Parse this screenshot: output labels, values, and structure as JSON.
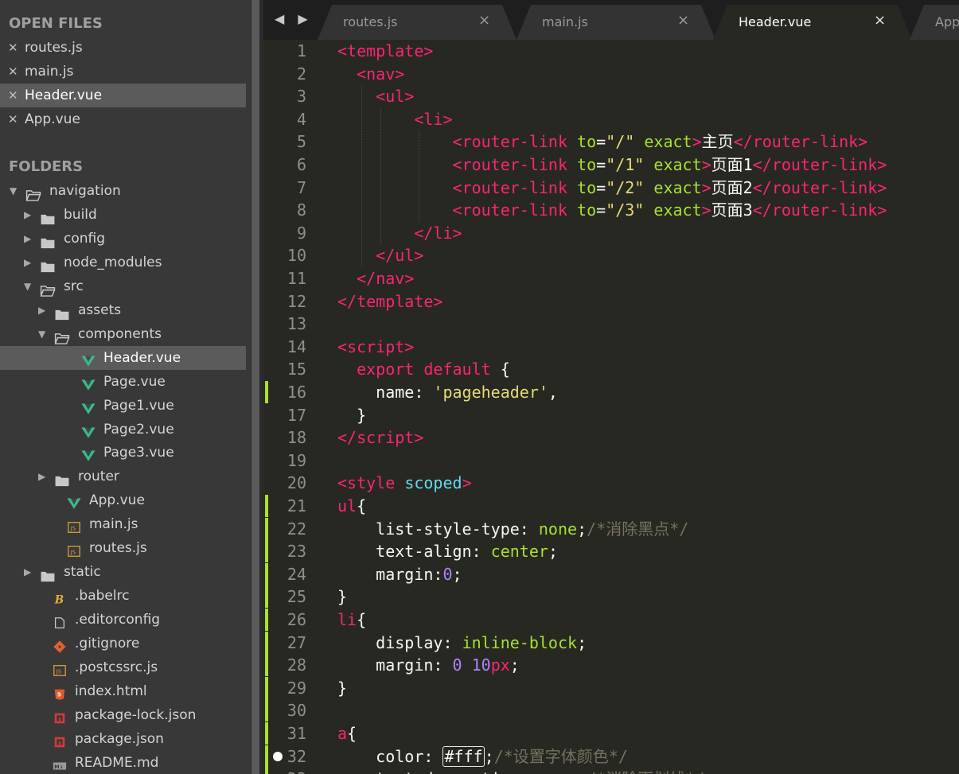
{
  "sidebar": {
    "open_files_heading": "OPEN FILES",
    "open_files": [
      {
        "label": "routes.js"
      },
      {
        "label": "main.js"
      },
      {
        "label": "Header.vue",
        "selected": true
      },
      {
        "label": "App.vue"
      }
    ],
    "folders_heading": "FOLDERS",
    "tree": [
      {
        "label": "navigation",
        "kind": "folder-open"
      },
      {
        "label": "build",
        "kind": "folder"
      },
      {
        "label": "config",
        "kind": "folder"
      },
      {
        "label": "node_modules",
        "kind": "folder"
      },
      {
        "label": "src",
        "kind": "folder-open"
      },
      {
        "label": "assets",
        "kind": "folder"
      },
      {
        "label": "components",
        "kind": "folder-open"
      },
      {
        "label": "Header.vue",
        "kind": "vue",
        "selected": true
      },
      {
        "label": "Page.vue",
        "kind": "vue"
      },
      {
        "label": "Page1.vue",
        "kind": "vue"
      },
      {
        "label": "Page2.vue",
        "kind": "vue"
      },
      {
        "label": "Page3.vue",
        "kind": "vue"
      },
      {
        "label": "router",
        "kind": "folder"
      },
      {
        "label": "App.vue",
        "kind": "vue"
      },
      {
        "label": "main.js",
        "kind": "js"
      },
      {
        "label": "routes.js",
        "kind": "js"
      },
      {
        "label": "static",
        "kind": "folder"
      },
      {
        "label": ".babelrc",
        "kind": "babel"
      },
      {
        "label": ".editorconfig",
        "kind": "file"
      },
      {
        "label": ".gitignore",
        "kind": "git"
      },
      {
        "label": ".postcssrc.js",
        "kind": "js"
      },
      {
        "label": "index.html",
        "kind": "html"
      },
      {
        "label": "package-lock.json",
        "kind": "npm"
      },
      {
        "label": "package.json",
        "kind": "npm"
      },
      {
        "label": "README.md",
        "kind": "md"
      }
    ]
  },
  "tabs": [
    {
      "label": "routes.js",
      "close": "×"
    },
    {
      "label": "main.js",
      "close": "×"
    },
    {
      "label": "Header.vue",
      "close": "×",
      "active": true
    },
    {
      "label": "App.vue",
      "close": ""
    }
  ],
  "nav_arrows": "◀ ▶",
  "editor": {
    "dirty_lines": [
      16,
      21,
      22,
      23,
      24,
      25,
      26,
      27,
      28,
      29,
      30,
      31,
      32,
      33
    ],
    "dot_line": 32,
    "lines": [
      [
        [
          "tg",
          "<"
        ],
        [
          "tg",
          "template"
        ],
        [
          "tg",
          ">"
        ]
      ],
      [
        [
          "pl",
          "  "
        ],
        [
          "tg",
          "<"
        ],
        [
          "tg",
          "nav"
        ],
        [
          "tg",
          ">"
        ]
      ],
      [
        [
          "pl",
          "    "
        ],
        [
          "tg",
          "<"
        ],
        [
          "tg",
          "ul"
        ],
        [
          "tg",
          ">"
        ]
      ],
      [
        [
          "pl",
          "        "
        ],
        [
          "tg",
          "<"
        ],
        [
          "tg",
          "li"
        ],
        [
          "tg",
          ">"
        ]
      ],
      [
        [
          "pl",
          "            "
        ],
        [
          "tg",
          "<"
        ],
        [
          "tg",
          "router-link"
        ],
        [
          "pl",
          " "
        ],
        [
          "at",
          "to"
        ],
        [
          "pl",
          "="
        ],
        [
          "st",
          "\"/\""
        ],
        [
          "pl",
          " "
        ],
        [
          "at",
          "exact"
        ],
        [
          "tg",
          ">"
        ],
        [
          "pl",
          "主页"
        ],
        [
          "tg",
          "</"
        ],
        [
          "tg",
          "router-link"
        ],
        [
          "tg",
          ">"
        ]
      ],
      [
        [
          "pl",
          "            "
        ],
        [
          "tg",
          "<"
        ],
        [
          "tg",
          "router-link"
        ],
        [
          "pl",
          " "
        ],
        [
          "at",
          "to"
        ],
        [
          "pl",
          "="
        ],
        [
          "st",
          "\"/1\""
        ],
        [
          "pl",
          " "
        ],
        [
          "at",
          "exact"
        ],
        [
          "tg",
          ">"
        ],
        [
          "pl",
          "页面1"
        ],
        [
          "tg",
          "</"
        ],
        [
          "tg",
          "router-link"
        ],
        [
          "tg",
          ">"
        ]
      ],
      [
        [
          "pl",
          "            "
        ],
        [
          "tg",
          "<"
        ],
        [
          "tg",
          "router-link"
        ],
        [
          "pl",
          " "
        ],
        [
          "at",
          "to"
        ],
        [
          "pl",
          "="
        ],
        [
          "st",
          "\"/2\""
        ],
        [
          "pl",
          " "
        ],
        [
          "at",
          "exact"
        ],
        [
          "tg",
          ">"
        ],
        [
          "pl",
          "页面2"
        ],
        [
          "tg",
          "</"
        ],
        [
          "tg",
          "router-link"
        ],
        [
          "tg",
          ">"
        ]
      ],
      [
        [
          "pl",
          "            "
        ],
        [
          "tg",
          "<"
        ],
        [
          "tg",
          "router-link"
        ],
        [
          "pl",
          " "
        ],
        [
          "at",
          "to"
        ],
        [
          "pl",
          "="
        ],
        [
          "st",
          "\"/3\""
        ],
        [
          "pl",
          " "
        ],
        [
          "at",
          "exact"
        ],
        [
          "tg",
          ">"
        ],
        [
          "pl",
          "页面3"
        ],
        [
          "tg",
          "</"
        ],
        [
          "tg",
          "router-link"
        ],
        [
          "tg",
          ">"
        ]
      ],
      [
        [
          "pl",
          "        "
        ],
        [
          "tg",
          "</"
        ],
        [
          "tg",
          "li"
        ],
        [
          "tg",
          ">"
        ]
      ],
      [
        [
          "pl",
          "    "
        ],
        [
          "tg",
          "</"
        ],
        [
          "tg",
          "ul"
        ],
        [
          "tg",
          ">"
        ]
      ],
      [
        [
          "pl",
          "  "
        ],
        [
          "tg",
          "</"
        ],
        [
          "tg",
          "nav"
        ],
        [
          "tg",
          ">"
        ]
      ],
      [
        [
          "tg",
          "</"
        ],
        [
          "tg",
          "template"
        ],
        [
          "tg",
          ">"
        ]
      ],
      [],
      [
        [
          "tg",
          "<"
        ],
        [
          "tg",
          "script"
        ],
        [
          "tg",
          ">"
        ]
      ],
      [
        [
          "pl",
          "  "
        ],
        [
          "kw",
          "export"
        ],
        [
          "pl",
          " "
        ],
        [
          "kw",
          "default"
        ],
        [
          "pl",
          " {"
        ]
      ],
      [
        [
          "pl",
          "    name: "
        ],
        [
          "st",
          "'pageheader'"
        ],
        [
          "pl",
          ","
        ]
      ],
      [
        [
          "pl",
          "  }"
        ]
      ],
      [
        [
          "tg",
          "</"
        ],
        [
          "tg",
          "script"
        ],
        [
          "tg",
          ">"
        ]
      ],
      [],
      [
        [
          "tg",
          "<"
        ],
        [
          "tg",
          "style"
        ],
        [
          "pl",
          " "
        ],
        [
          "sc",
          "scoped"
        ],
        [
          "tg",
          ">"
        ]
      ],
      [
        [
          "sel",
          "ul"
        ],
        [
          "pl",
          "{"
        ]
      ],
      [
        [
          "pl",
          "    "
        ],
        [
          "pr",
          "list-style-type"
        ],
        [
          "pl",
          ": "
        ],
        [
          "vl",
          "none"
        ],
        [
          "pl",
          ";"
        ],
        [
          "cm",
          "/*消除黑点*/"
        ]
      ],
      [
        [
          "pl",
          "    "
        ],
        [
          "pr",
          "text-align"
        ],
        [
          "pl",
          ": "
        ],
        [
          "vl",
          "center"
        ],
        [
          "pl",
          ";"
        ]
      ],
      [
        [
          "pl",
          "    "
        ],
        [
          "pr",
          "margin"
        ],
        [
          "pl",
          ":"
        ],
        [
          "nm",
          "0"
        ],
        [
          "pl",
          ";"
        ]
      ],
      [
        [
          "pl",
          "}"
        ]
      ],
      [
        [
          "sel",
          "li"
        ],
        [
          "pl",
          "{"
        ]
      ],
      [
        [
          "pl",
          "    "
        ],
        [
          "pr",
          "display"
        ],
        [
          "pl",
          ": "
        ],
        [
          "vl",
          "inline-block"
        ],
        [
          "pl",
          ";"
        ]
      ],
      [
        [
          "pl",
          "    "
        ],
        [
          "pr",
          "margin"
        ],
        [
          "pl",
          ": "
        ],
        [
          "nm",
          "0"
        ],
        [
          "pl",
          " "
        ],
        [
          "nm",
          "10"
        ],
        [
          "un",
          "px"
        ],
        [
          "pl",
          ";"
        ]
      ],
      [
        [
          "pl",
          "}"
        ]
      ],
      [],
      [
        [
          "sel",
          "a"
        ],
        [
          "pl",
          "{"
        ]
      ],
      [
        [
          "pl",
          "    "
        ],
        [
          "pr",
          "color"
        ],
        [
          "pl",
          ": "
        ],
        [
          "hl",
          "#fff"
        ],
        [
          "pl",
          ";"
        ],
        [
          "cm",
          "/*设置字体颜色*/"
        ]
      ],
      [
        [
          "pl",
          "    "
        ],
        [
          "pr",
          "text-decoration"
        ],
        [
          "pl",
          ": "
        ],
        [
          "vl",
          "none"
        ],
        [
          "pl",
          ";"
        ],
        [
          "cm",
          "/*消除下划线*/"
        ]
      ]
    ]
  },
  "colors": {
    "sidebar_bg": "#383838",
    "editor_bg": "#272822",
    "tag": "#f92672",
    "attr": "#a6e22e",
    "string": "#e6db74",
    "comment": "#75715e",
    "number": "#ae81ff"
  }
}
